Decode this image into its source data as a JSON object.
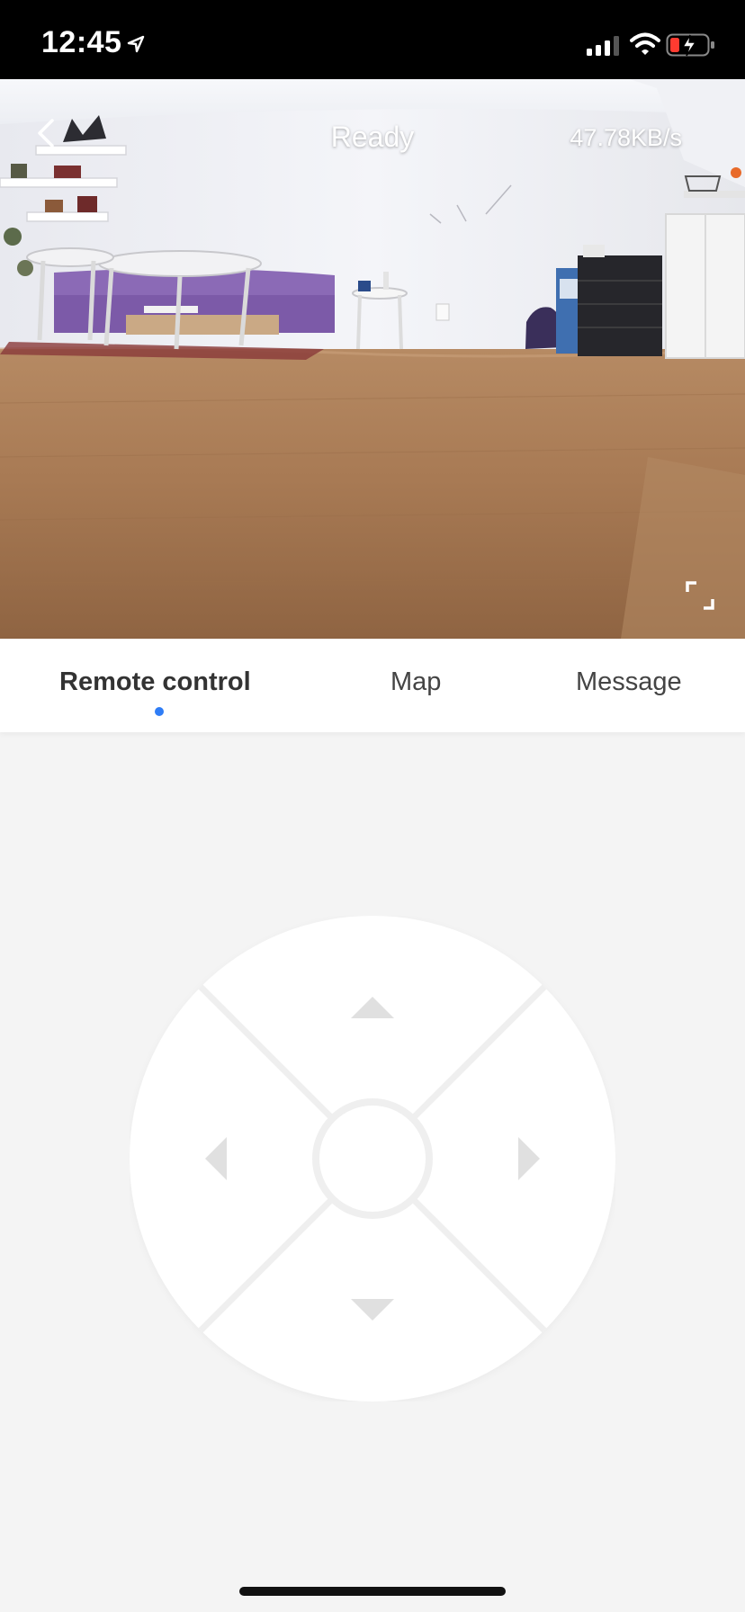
{
  "status_bar": {
    "time": "12:45",
    "icons": [
      "location-arrow-icon",
      "signal-icon",
      "wifi-icon",
      "battery-charging-icon"
    ]
  },
  "camera": {
    "status": "Ready",
    "speed": "47.78KB/s",
    "back_icon": "chevron-left-icon",
    "fullscreen_icon": "fullscreen-icon"
  },
  "tabs": [
    {
      "label": "Remote control",
      "active": true
    },
    {
      "label": "Map",
      "active": false
    },
    {
      "label": "Message",
      "active": false
    }
  ],
  "dpad": {
    "icons": [
      "arrow-up-icon",
      "arrow-down-icon",
      "arrow-left-icon",
      "arrow-right-icon",
      "center-button"
    ]
  },
  "colors": {
    "accent": "#2f7df6",
    "background": "#f4f4f4",
    "dpad_surface": "#ffffff",
    "dpad_lines": "#efefef",
    "arrow": "#e0e0e0"
  }
}
